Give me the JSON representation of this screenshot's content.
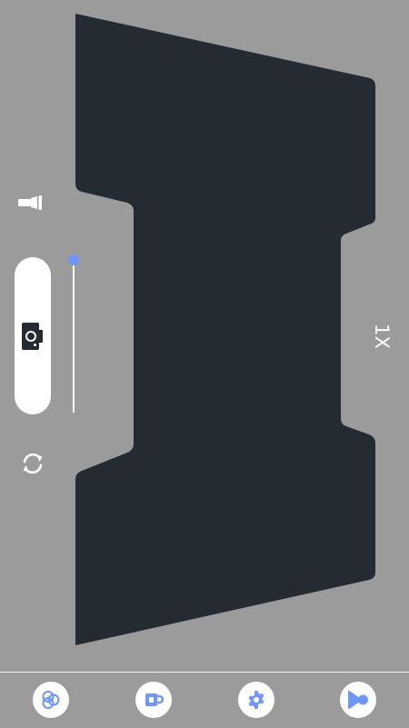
{
  "camera": {
    "zoom_label": "1X",
    "zoom_fraction": 0.0,
    "accent_color": "#6f95ff",
    "frame_color": "#242b33",
    "background_color": "#9b9b9b"
  },
  "controls": {
    "flash_icon": "flashlight-icon",
    "shutter_icon": "camera-icon",
    "switch_icon": "switch-camera-icon"
  },
  "bottom_nav": {
    "items": [
      {
        "icon": "filters-icon"
      },
      {
        "icon": "cup-icon"
      },
      {
        "icon": "gear-icon"
      },
      {
        "icon": "video-record-icon"
      }
    ]
  }
}
